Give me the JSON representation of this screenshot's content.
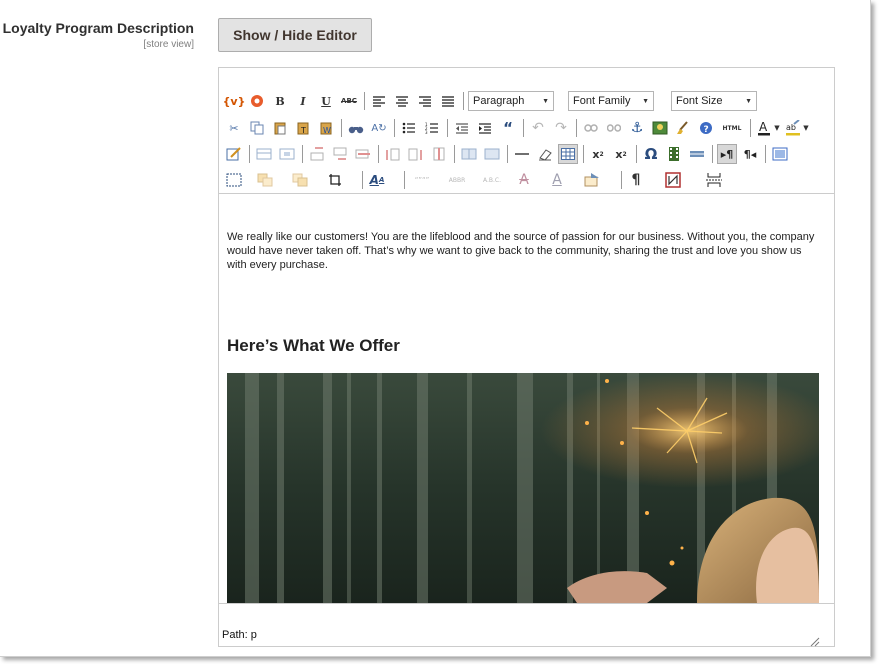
{
  "field": {
    "label": "Loyalty Program Description",
    "scope": "[store view]",
    "toggle_button": "Show / Hide Editor"
  },
  "toolbar": {
    "format_select": "Paragraph",
    "font_family_select": "Font Family",
    "font_size_select": "Font Size",
    "bold": "B",
    "italic": "I",
    "underline": "U",
    "strike": "ABC",
    "html_label": "HTML",
    "omega": "Ω",
    "pilcrow": "¶"
  },
  "content": {
    "paragraph": "We really like our customers! You are the lifeblood and the source of passion for our business. Without you, the company would have never taken off. That’s why we want to give back to the community, sharing the trust and love you show us with every purchase.",
    "heading": "Here’s What We Offer"
  },
  "status": {
    "path": "Path: p"
  },
  "colors": {
    "border": "#cccccc",
    "button_bg": "#e3e3e3",
    "label_text": "#303030"
  }
}
